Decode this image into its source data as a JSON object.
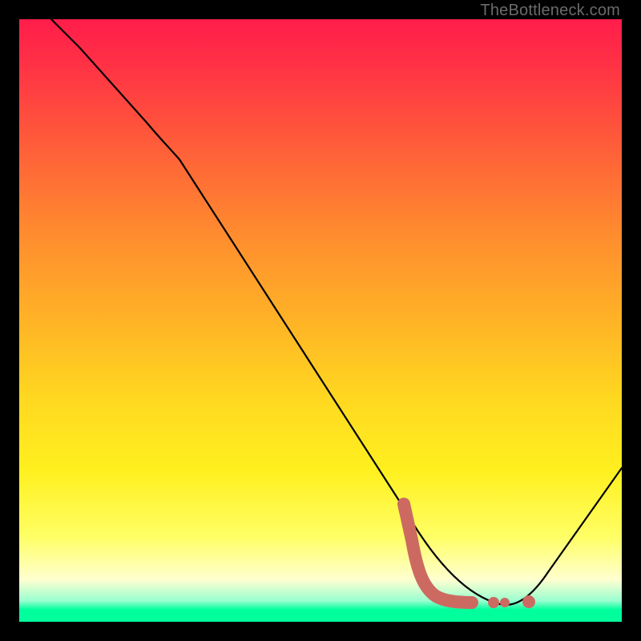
{
  "watermark": "TheBottleneck.com",
  "chart_data": {
    "type": "line",
    "title": "",
    "xlabel": "",
    "ylabel": "",
    "xlim": [
      0,
      100
    ],
    "ylim": [
      0,
      100
    ],
    "grid": false,
    "series": [
      {
        "name": "bottleneck-curve",
        "x": [
          0,
          10,
          20,
          30,
          40,
          50,
          60,
          65,
          70,
          75,
          80,
          85,
          90,
          95,
          100
        ],
        "y": [
          108,
          96,
          82,
          76,
          64,
          52,
          40,
          31,
          20,
          10,
          3,
          0,
          4,
          14,
          26
        ]
      }
    ],
    "annotations": [
      {
        "name": "highlight-l-shape",
        "kind": "polyline",
        "points_xy": [
          [
            64,
            22
          ],
          [
            65,
            14
          ],
          [
            66,
            8
          ],
          [
            68,
            4
          ],
          [
            72,
            3
          ],
          [
            76,
            3
          ]
        ]
      },
      {
        "name": "highlight-dot-1",
        "kind": "dot",
        "xy": [
          79,
          3
        ]
      },
      {
        "name": "highlight-dot-2",
        "kind": "dot",
        "xy": [
          83,
          3
        ]
      }
    ],
    "colors": {
      "curve": "#000000",
      "highlight": "#cc6a62",
      "gradient_top": "#ff1d4a",
      "gradient_bottom": "#00ff9c"
    }
  }
}
